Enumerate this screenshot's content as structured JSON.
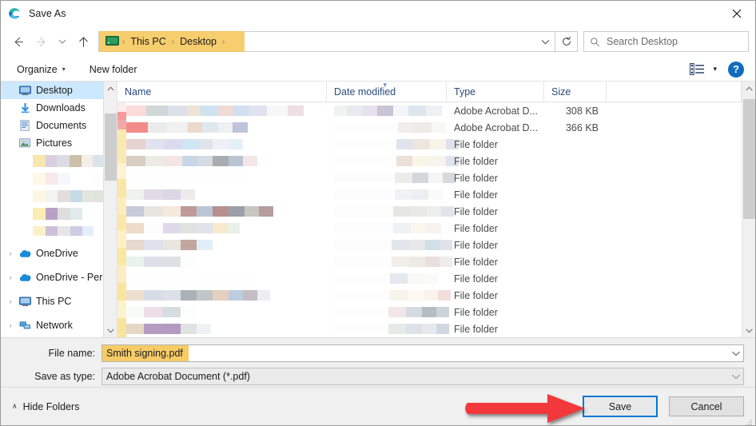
{
  "window": {
    "title": "Save As",
    "app_icon": "edge-logo-icon",
    "close_label": "✕"
  },
  "nav": {
    "back_icon": "arrow-left-icon",
    "forward_icon": "arrow-right-icon",
    "recent_icon": "chevron-down-icon",
    "up_icon": "arrow-up-icon",
    "breadcrumb": {
      "root_icon": "this-pc-icon",
      "separator": "›",
      "items": [
        "This PC",
        "Desktop"
      ],
      "dropdown_icon": "chevron-down-icon"
    },
    "refresh_icon": "refresh-icon",
    "search": {
      "icon": "search-icon",
      "placeholder": "Search Desktop",
      "value": ""
    }
  },
  "commandbar": {
    "organize_label": "Organize",
    "organize_caret": "▾",
    "new_folder_label": "New folder",
    "view_icon": "view-options-icon",
    "view_caret": "▾",
    "help_label": "?"
  },
  "sidebar": {
    "items": [
      {
        "label": "Desktop",
        "icon": "desktop-icon",
        "pinned": true,
        "selected": true,
        "expandable": false,
        "redacted": false
      },
      {
        "label": "Downloads",
        "icon": "downloads-icon",
        "pinned": true,
        "selected": false,
        "expandable": false,
        "redacted": false
      },
      {
        "label": "Documents",
        "icon": "documents-icon",
        "pinned": true,
        "selected": false,
        "expandable": false,
        "redacted": false
      },
      {
        "label": "Pictures",
        "icon": "pictures-icon",
        "pinned": true,
        "selected": false,
        "expandable": false,
        "redacted": false
      },
      {
        "label": "",
        "icon": "folder-icon",
        "pinned": true,
        "selected": false,
        "expandable": false,
        "redacted": true
      },
      {
        "label": "",
        "icon": "folder-icon",
        "pinned": true,
        "selected": false,
        "expandable": false,
        "redacted": true
      },
      {
        "label": "",
        "icon": "folder-icon",
        "pinned": true,
        "selected": false,
        "expandable": false,
        "redacted": true
      },
      {
        "label": "",
        "icon": "folder-icon",
        "pinned": true,
        "selected": false,
        "expandable": false,
        "redacted": true
      },
      {
        "label": "OneDrive",
        "icon": "onedrive-icon",
        "pinned": false,
        "selected": false,
        "expandable": true,
        "redacted": false
      },
      {
        "label": "OneDrive - Personal",
        "icon": "onedrive-icon",
        "pinned": false,
        "selected": false,
        "expandable": true,
        "redacted": false
      },
      {
        "label": "This PC",
        "icon": "this-pc-icon",
        "pinned": false,
        "selected": false,
        "expandable": true,
        "redacted": false
      },
      {
        "label": "Network",
        "icon": "network-icon",
        "pinned": false,
        "selected": false,
        "expandable": true,
        "redacted": false
      }
    ],
    "scroll_up_icon": "chevron-up-icon",
    "scroll_down_icon": "chevron-down-icon"
  },
  "filelist": {
    "columns": [
      "Name",
      "Date modified",
      "Type",
      "Size"
    ],
    "sort_column": "Date modified",
    "sort_caret": "▾",
    "rows": [
      {
        "name": "",
        "date": "",
        "type": "Adobe Acrobat D...",
        "size": "308 KB",
        "redacted": true
      },
      {
        "name": "",
        "date": "",
        "type": "Adobe Acrobat D...",
        "size": "366 KB",
        "redacted": true
      },
      {
        "name": "",
        "date": "",
        "type": "File folder",
        "size": "",
        "redacted": true
      },
      {
        "name": "",
        "date": "",
        "type": "File folder",
        "size": "",
        "redacted": true
      },
      {
        "name": "",
        "date": "",
        "type": "File folder",
        "size": "",
        "redacted": true
      },
      {
        "name": "",
        "date": "",
        "type": "File folder",
        "size": "",
        "redacted": true
      },
      {
        "name": "",
        "date": "",
        "type": "File folder",
        "size": "",
        "redacted": true
      },
      {
        "name": "",
        "date": "",
        "type": "File folder",
        "size": "",
        "redacted": true
      },
      {
        "name": "",
        "date": "",
        "type": "File folder",
        "size": "",
        "redacted": true
      },
      {
        "name": "",
        "date": "",
        "type": "File folder",
        "size": "",
        "redacted": true
      },
      {
        "name": "",
        "date": "",
        "type": "File folder",
        "size": "",
        "redacted": true
      },
      {
        "name": "",
        "date": "",
        "type": "File folder",
        "size": "",
        "redacted": true
      },
      {
        "name": "",
        "date": "",
        "type": "File folder",
        "size": "",
        "redacted": true
      },
      {
        "name": "",
        "date": "",
        "type": "File folder",
        "size": "",
        "redacted": true
      }
    ],
    "scroll_up_icon": "chevron-up-icon",
    "scroll_down_icon": "chevron-down-icon"
  },
  "fields": {
    "filename_label": "File name:",
    "filename_value": "Smith signing.pdf",
    "filetype_label": "Save as type:",
    "filetype_value": "Adobe Acrobat Document (*.pdf)",
    "caret_icon": "chevron-down-icon"
  },
  "footer": {
    "hide_folders_label": "Hide Folders",
    "hide_folders_caret": "∧",
    "save_label": "Save",
    "cancel_label": "Cancel",
    "resize_grip_icon": "resize-grip-icon"
  },
  "annotation": {
    "arrow_icon": "red-arrow-right-icon",
    "points_to": "Save"
  },
  "colors": {
    "accent_blue": "#0078d7",
    "highlight_amber": "#f6c555",
    "selection_blue": "#cce8ff",
    "annotation_red": "#f2383a",
    "header_text": "#2b4a7d"
  }
}
